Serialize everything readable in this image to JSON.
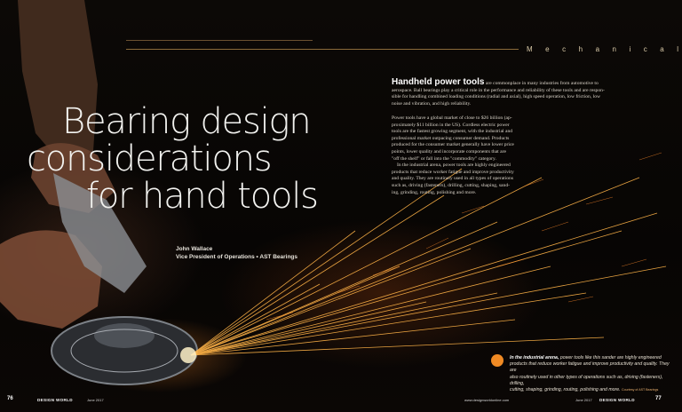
{
  "section": "Mechanical",
  "headline": {
    "line1": "Bearing design",
    "line2": "considerations",
    "line3": "for hand tools"
  },
  "author": {
    "name": "John Wallace",
    "title": "Vice President of Operations • AST Bearings"
  },
  "lead": {
    "heading": "Handheld power tools",
    "text1": "are commonplace in many industries from automotive to",
    "text2": "aerospace. Ball bearings play a critical role in the performance and reliability of these tools and are respon-",
    "text3": "sible for handling combined loading conditions (radial and axial), high speed operation, low friction, low",
    "text4": "noise and vibration, and high reliability."
  },
  "body_lines": [
    "Power tools have a global market of close to $26 billion (ap-",
    "proximately $11 billion in the US). Cordless electric power",
    "tools are the fastest growing segment, with the industrial and",
    "professional market outpacing consumer demand. Products",
    "produced for the consumer market generally have lower price",
    "points, lower quality and incorporate components that are",
    "\"off the shelf\" or fall into the \"commodity\" category.",
    "In the industrial arena, power tools are highly engineered",
    "products that reduce worker fatigue and improve productivity",
    "and quality. They are routinely used in all types of operations",
    "such as, driving (fasteners), drilling, cutting, shaping, sand-",
    "ing, grinding, routing, polishing and more."
  ],
  "caption": {
    "lead": "In the industrial arena,",
    "line1": "power tools like this sander are highly engineered",
    "line2": "products that reduce worker fatigue and improve productivity and quality. They are",
    "line3": "also routinely used in other types of operations such as, driving (fasteners), drilling,",
    "line4": "cutting, shaping, grinding, routing, polishing and more.",
    "credit": "Courtesy of AST Bearings"
  },
  "footer": {
    "left_page": "76",
    "left_mag": "DESIGN WORLD",
    "left_date": "June 2017",
    "url": "www.designworldonline.com",
    "right_date": "June 2017",
    "right_mag": "DESIGN WORLD",
    "right_page": "77"
  },
  "colors": {
    "accent": "#f08a24",
    "rule": "#8a6a3a",
    "headline": "#f2f2ef"
  }
}
